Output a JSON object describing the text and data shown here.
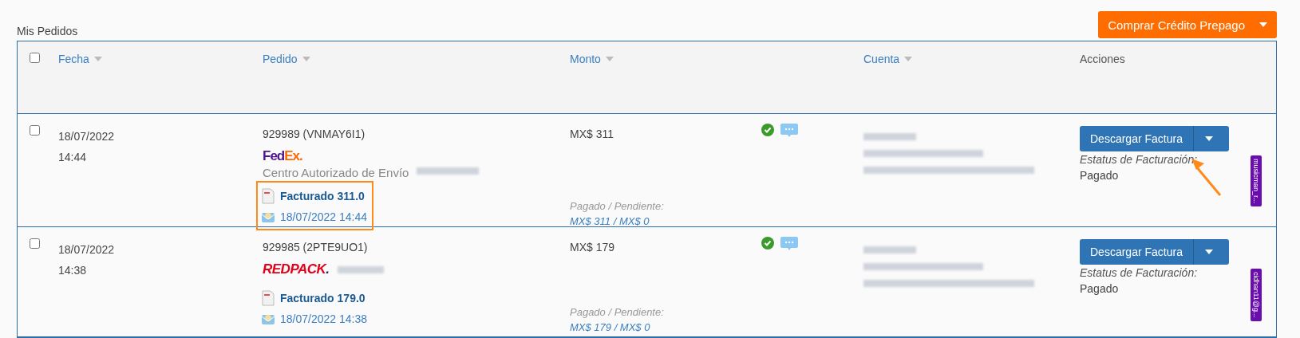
{
  "page_title": "Mis Pedidos",
  "buy_button": {
    "label": "Comprar Crédito Prepago"
  },
  "table": {
    "select_all": {
      "checked": false
    },
    "columns": [
      {
        "label": "Fecha",
        "sortable": true
      },
      {
        "label": "Pedido",
        "sortable": true
      },
      {
        "label": "Monto",
        "sortable": true
      },
      {
        "label": "Cuenta",
        "sortable": true
      },
      {
        "label": "Acciones",
        "sortable": false
      }
    ],
    "rows": [
      {
        "checked": false,
        "date": "18/07/2022",
        "time": "14:44",
        "order": "929989 (VNMAY6I1)",
        "carrier": {
          "kind": "fedex",
          "parts": [
            "Fed",
            "Ex"
          ],
          "dot": "."
        },
        "carrier_note": "Centro Autorizado de Envío",
        "invoice": "Facturado 311.0",
        "invoice_date": "18/07/2022 14:44",
        "highlighted": true,
        "amount": "MX$ 311",
        "paid_label": "Pagado / Pendiente:",
        "paid_values": "MX$ 311 / MX$ 0",
        "verified": true,
        "action": "Descargar Factura",
        "status_label": "Estatus de Facturación:",
        "status": "Pagado",
        "arrow": true,
        "tag": "musicman_r..."
      },
      {
        "checked": false,
        "date": "18/07/2022",
        "time": "14:38",
        "order": "929985 (2PTE9UO1)",
        "carrier": {
          "kind": "redpack",
          "parts": [
            "REDPACK"
          ],
          "dot": "."
        },
        "invoice": "Facturado 179.0",
        "invoice_date": "18/07/2022 14:38",
        "highlighted": false,
        "amount": "MX$ 179",
        "paid_label": "Pagado / Pendiente:",
        "paid_values": "MX$ 179 / MX$ 0",
        "verified": true,
        "action": "Descargar Factura",
        "status_label": "Estatus de Facturación:",
        "status": "Pagado",
        "arrow": false,
        "tag": "cidhan11@g..."
      }
    ]
  }
}
